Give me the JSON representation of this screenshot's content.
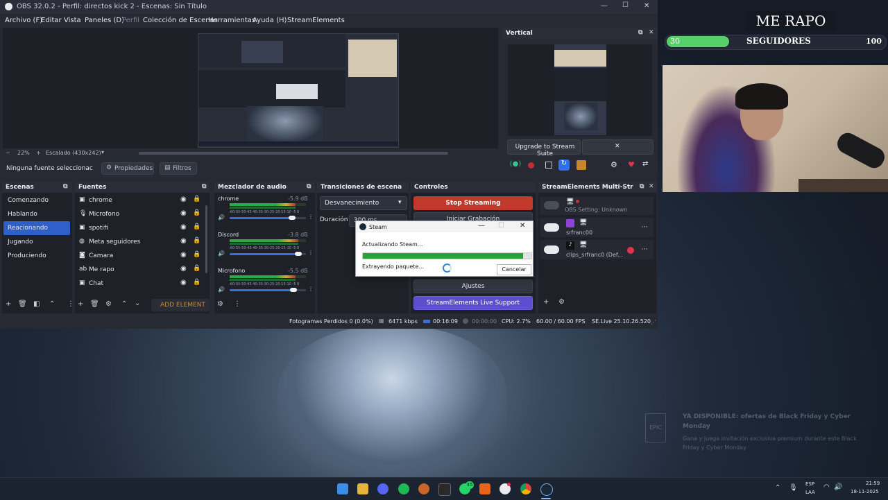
{
  "window": {
    "title": "OBS 32.0.2 - Perfil: directos kick 2 - Escenas: Sin Título",
    "controls": [
      "—",
      "☐",
      "✕"
    ]
  },
  "menu": [
    "Archivo (F)",
    "Editar",
    "Vista",
    "Paneles (D)",
    "Perfil",
    "Colección de Escenas",
    "Herramientas",
    "Ayuda (H)",
    "StreamElements"
  ],
  "zoombar": {
    "minus": "−",
    "zoom": "22%",
    "plus": "+",
    "scale": "Escalado (430x242)"
  },
  "sourcebar": {
    "selected": "Ninguna fuente seleccionac",
    "props": "Propiedades",
    "filters": "Filtros"
  },
  "vertical": {
    "title": "Vertical",
    "upgrade": "Upgrade to Stream Suite",
    "close": "✕"
  },
  "scenes": {
    "title": "Escenas",
    "items": [
      "Comenzando",
      "Hablando",
      "Reacionando",
      "Jugando",
      "Produciendo"
    ],
    "selected_index": 2
  },
  "sources": {
    "title": "Fuentes",
    "items": [
      "chrome",
      "Microfono",
      "spotifi",
      "Meta seguidores",
      "Camara",
      "Me rapo",
      "Chat"
    ],
    "add_element": "ADD ELEMENT"
  },
  "mixer": {
    "title": "Mezclador de audio",
    "scale": "-60-55-50-45-40-35-30-25-20-15-10 -5  0",
    "channels": [
      {
        "name": "chrome",
        "db": "-5.9 dB",
        "level": 0.86,
        "volume": 0.82
      },
      {
        "name": "Discord",
        "db": "-3.8 dB",
        "level": 0.9,
        "volume": 0.9
      },
      {
        "name": "Microfono",
        "db": "-5.5 dB",
        "level": 0.86,
        "volume": 0.84
      }
    ]
  },
  "transitions": {
    "title": "Transiciones de escena",
    "type": "Desvanecimiento",
    "duration_label": "Duración",
    "duration_value": "300 ms"
  },
  "controls": {
    "title": "Controles",
    "stop_streaming": "Stop Streaming",
    "record": "Iniciar Grabación",
    "settings": "Ajustes",
    "support": "StreamElements Live Support"
  },
  "multistream": {
    "title": "StreamElements Multi-Strea...",
    "items": [
      {
        "label": "OBS Setting: Unknown",
        "muted": true
      },
      {
        "label": "srfranc00",
        "muted": false
      },
      {
        "label": "clips_srfranc0 (Def...",
        "muted": false
      }
    ]
  },
  "steam": {
    "title": "Steam",
    "line1": "Actualizando Steam...",
    "line2": "Extrayendo paquete...",
    "cancel": "Cancelar",
    "progress": 0.95
  },
  "status": {
    "dropped": "Fotogramas Perdidos 0 (0.0%)",
    "bitrate": "6471 kbps",
    "live_time": "00:16:09",
    "rec_time": "00:00:00",
    "cpu": "CPU: 2.7%",
    "fps": "60.00 / 60.00 FPS",
    "se": "SE.Live 25.10.26.520"
  },
  "overlay": {
    "title": "ME RAPO",
    "followers_label": "SEGUIDORES",
    "current": "30",
    "goal": "100",
    "progress": 0.3
  },
  "notification": {
    "title": "YA DISPONIBLE: ofertas de Black Friday y Cyber Monday",
    "body": "Gana y juega invitación exclusiva premium durante este Black Friday y Cyber Monday"
  },
  "taskbar": {
    "lang1": "ESP",
    "lang2": "LAA",
    "time": "21:59",
    "date": "18-11-2025",
    "whatsapp_badge": "45"
  },
  "colors": {
    "accent": "#2f5fc8",
    "stop": "#c0392b",
    "overlay_green": "#58d06a",
    "support": "#5b4fcf"
  }
}
